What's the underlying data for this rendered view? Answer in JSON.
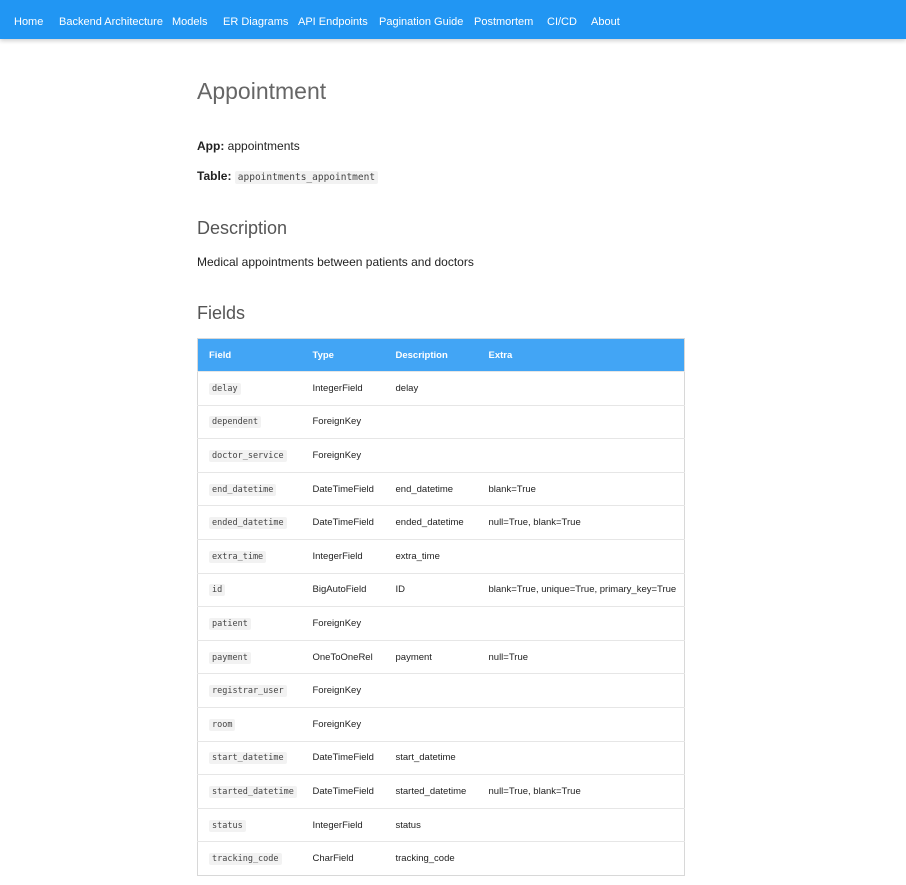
{
  "nav": {
    "items": [
      {
        "label": "Home"
      },
      {
        "label": "Backend Architecture"
      },
      {
        "label": "Models"
      },
      {
        "label": "ER Diagrams"
      },
      {
        "label": "API Endpoints"
      },
      {
        "label": "Pagination Guide"
      },
      {
        "label": "Postmortem"
      },
      {
        "label": "CI/CD"
      },
      {
        "label": "About"
      }
    ]
  },
  "page": {
    "title": "Appointment",
    "app_label": "App:",
    "app_value": "appointments",
    "table_label": "Table:",
    "table_value": "appointments_appointment",
    "description_heading": "Description",
    "description_text": "Medical appointments between patients and doctors",
    "fields_heading": "Fields"
  },
  "fields_table": {
    "headers": [
      "Field",
      "Type",
      "Description",
      "Extra"
    ],
    "rows": [
      {
        "field": "delay",
        "type": "IntegerField",
        "description": "delay",
        "extra": ""
      },
      {
        "field": "dependent",
        "type": "ForeignKey",
        "description": "",
        "extra": ""
      },
      {
        "field": "doctor_service",
        "type": "ForeignKey",
        "description": "",
        "extra": ""
      },
      {
        "field": "end_datetime",
        "type": "DateTimeField",
        "description": "end_datetime",
        "extra": "blank=True"
      },
      {
        "field": "ended_datetime",
        "type": "DateTimeField",
        "description": "ended_datetime",
        "extra": "null=True, blank=True"
      },
      {
        "field": "extra_time",
        "type": "IntegerField",
        "description": "extra_time",
        "extra": ""
      },
      {
        "field": "id",
        "type": "BigAutoField",
        "description": "ID",
        "extra": "blank=True, unique=True, primary_key=True"
      },
      {
        "field": "patient",
        "type": "ForeignKey",
        "description": "",
        "extra": ""
      },
      {
        "field": "payment",
        "type": "OneToOneRel",
        "description": "payment",
        "extra": "null=True"
      },
      {
        "field": "registrar_user",
        "type": "ForeignKey",
        "description": "",
        "extra": ""
      },
      {
        "field": "room",
        "type": "ForeignKey",
        "description": "",
        "extra": ""
      },
      {
        "field": "start_datetime",
        "type": "DateTimeField",
        "description": "start_datetime",
        "extra": ""
      },
      {
        "field": "started_datetime",
        "type": "DateTimeField",
        "description": "started_datetime",
        "extra": "null=True, blank=True"
      },
      {
        "field": "status",
        "type": "IntegerField",
        "description": "status",
        "extra": ""
      },
      {
        "field": "tracking_code",
        "type": "CharField",
        "description": "tracking_code",
        "extra": ""
      }
    ]
  },
  "colors": {
    "nav_background": "#2196f3",
    "table_header_background": "#42a5f5"
  }
}
